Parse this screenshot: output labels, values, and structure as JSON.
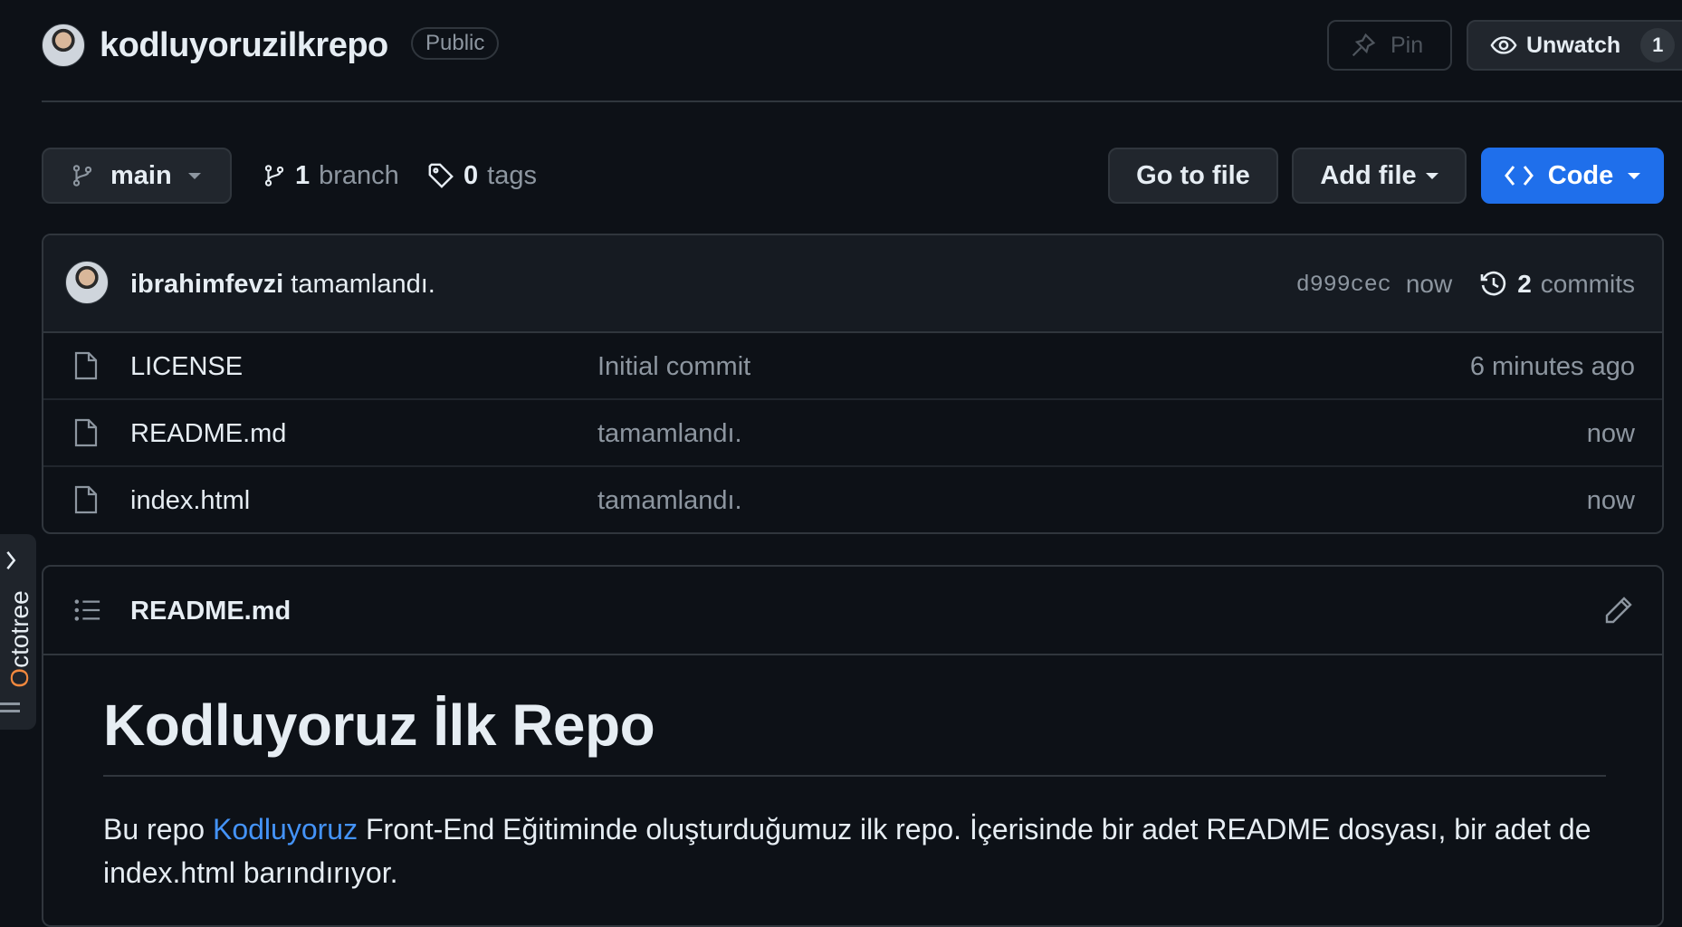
{
  "repo": {
    "name": "kodluyoruzilkrepo",
    "visibility": "Public",
    "pin_label": "Pin",
    "unwatch_label": "Unwatch",
    "watch_count": "1"
  },
  "toolbar": {
    "branch": "main",
    "branch_count": "1",
    "branch_label": "branch",
    "tag_count": "0",
    "tag_label": "tags",
    "go_to_file": "Go to file",
    "add_file": "Add file",
    "code": "Code"
  },
  "latest_commit": {
    "author": "ibrahimfevzi",
    "message": "tamamlandı.",
    "sha": "d999cec",
    "time": "now",
    "commit_count": "2",
    "commit_label": "commits"
  },
  "files": [
    {
      "name": "LICENSE",
      "message": "Initial commit",
      "age": "6 minutes ago"
    },
    {
      "name": "README.md",
      "message": "tamamlandı.",
      "age": "now"
    },
    {
      "name": "index.html",
      "message": "tamamlandı.",
      "age": "now"
    }
  ],
  "readme": {
    "filename": "README.md",
    "heading": "Kodluyoruz İlk Repo",
    "para_before": "Bu repo ",
    "link_text": "Kodluyoruz",
    "para_after": " Front-End Eğitiminde oluşturduğumuz ilk repo. İçerisinde bir adet README dosyası, bir adet de index.html barındırıyor."
  },
  "octotree": {
    "first_letter": "O",
    "rest": "ctotree"
  },
  "colors": {
    "background": "#0d1117",
    "accent": "#1f6feb",
    "link": "#4493f8",
    "muted": "#8d96a0",
    "octotree_orange": "#f0883e"
  }
}
